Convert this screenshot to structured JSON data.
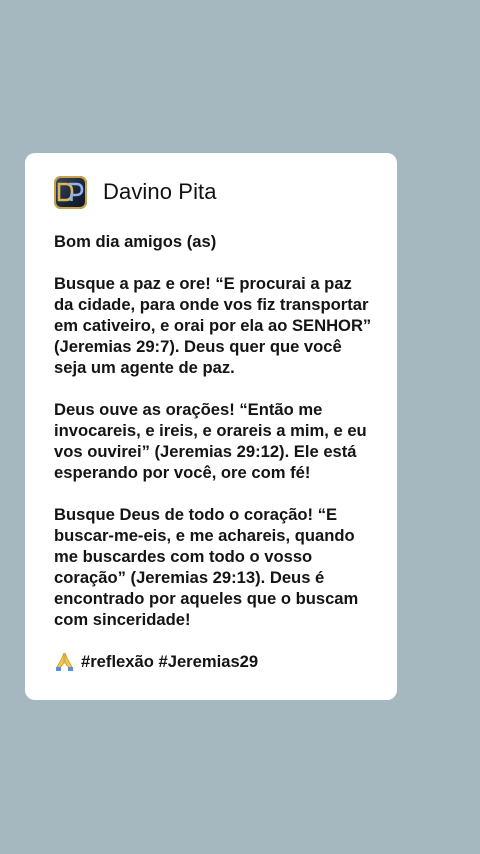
{
  "post": {
    "author": "Davino Pita",
    "avatar_monogram": "DP",
    "avatar_colors": {
      "background": "#1c2638",
      "accent": "#c9a349"
    },
    "paragraphs": [
      "Bom dia amigos (as)",
      "Busque a paz e ore! “E procurai a paz da cidade, para onde vos fiz transportar em cativeiro, e orai por ela ao SENHOR” (Jeremias 29:7). Deus quer que você seja um agente de paz.",
      "Deus ouve as orações! “Então me invocareis, e ireis, e orareis a mim, e eu vos ouvirei” (Jeremias 29:12). Ele está esperando por você, ore com fé!",
      "Busque Deus de todo o coração! “E buscar-me-eis, e me achareis, quando me buscardes com todo o vosso coração” (Jeremias 29:13). Deus é encontrado por aqueles que o buscam com sinceridade!"
    ],
    "hashtags_icon": "praying-hands-icon",
    "hashtags": "#reflexão #Jeremias29"
  },
  "colors": {
    "page_background": "#a6b8bf",
    "card_background": "#ffffff",
    "text": "#141414"
  }
}
